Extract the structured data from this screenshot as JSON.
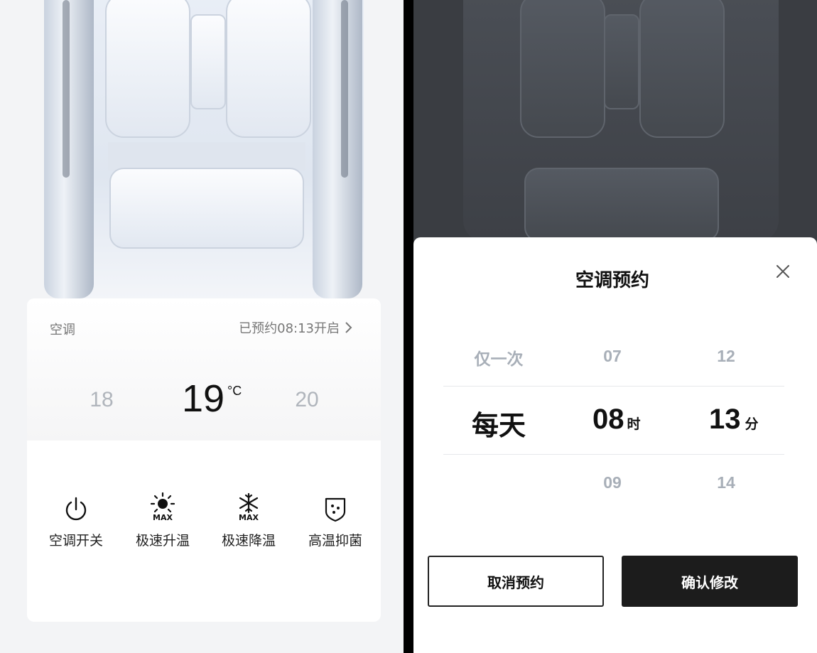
{
  "left_screen": {
    "card": {
      "title": "空调",
      "schedule_status": "已预约08:13开启",
      "temps": {
        "lower": "18",
        "current": "19",
        "unit": "°C",
        "higher": "20"
      },
      "controls": [
        {
          "label": "空调开关",
          "icon": "power-icon"
        },
        {
          "label": "极速升温",
          "icon": "sun-max-icon"
        },
        {
          "label": "极速降温",
          "icon": "snowflake-max-icon"
        },
        {
          "label": "高温抑菌",
          "icon": "shield-dots-icon"
        }
      ],
      "max_badge": "MAX"
    }
  },
  "right_screen": {
    "sheet": {
      "title": "空调预约",
      "picker": {
        "repeat": {
          "above": "仅一次",
          "selected": "每天"
        },
        "hour": {
          "above": "07",
          "selected": "08",
          "unit": "时",
          "below": "09"
        },
        "minute": {
          "above": "12",
          "selected": "13",
          "unit": "分",
          "below": "14"
        }
      },
      "cancel_button": "取消预约",
      "confirm_button": "确认修改"
    }
  },
  "colors": {
    "dark_button": "#1c1c1c",
    "muted_text": "#a8afb8",
    "card_bg": "#ffffff"
  }
}
